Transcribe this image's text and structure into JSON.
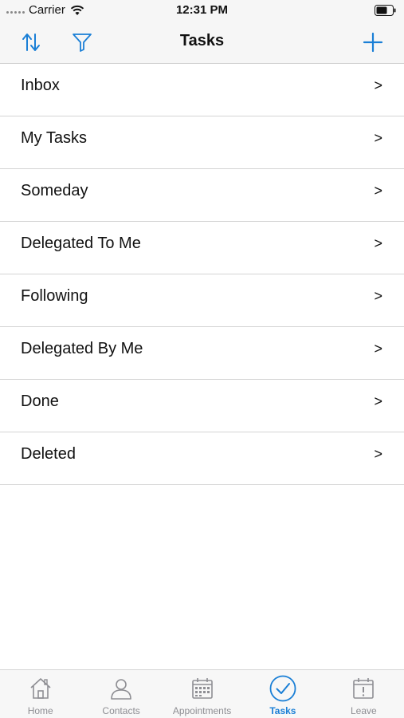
{
  "status_bar": {
    "carrier": "Carrier",
    "time": "12:31 PM"
  },
  "header": {
    "title": "Tasks",
    "left_icons": [
      "sort-icon",
      "filter-icon"
    ],
    "right_icon": "plus-icon",
    "accent_color": "#1a7fd6"
  },
  "list": {
    "chevron": ">",
    "items": [
      {
        "label": "Inbox"
      },
      {
        "label": "My Tasks"
      },
      {
        "label": "Someday"
      },
      {
        "label": "Delegated To Me"
      },
      {
        "label": "Following"
      },
      {
        "label": "Delegated By Me"
      },
      {
        "label": "Done"
      },
      {
        "label": "Deleted"
      }
    ]
  },
  "tabs": [
    {
      "label": "Home",
      "icon": "home-icon"
    },
    {
      "label": "Contacts",
      "icon": "contact-icon"
    },
    {
      "label": "Appointments",
      "icon": "calendar-icon"
    },
    {
      "label": "Tasks",
      "icon": "checkmark-circle-icon",
      "active": true
    },
    {
      "label": "Leave",
      "icon": "calendar-alert-icon"
    }
  ]
}
